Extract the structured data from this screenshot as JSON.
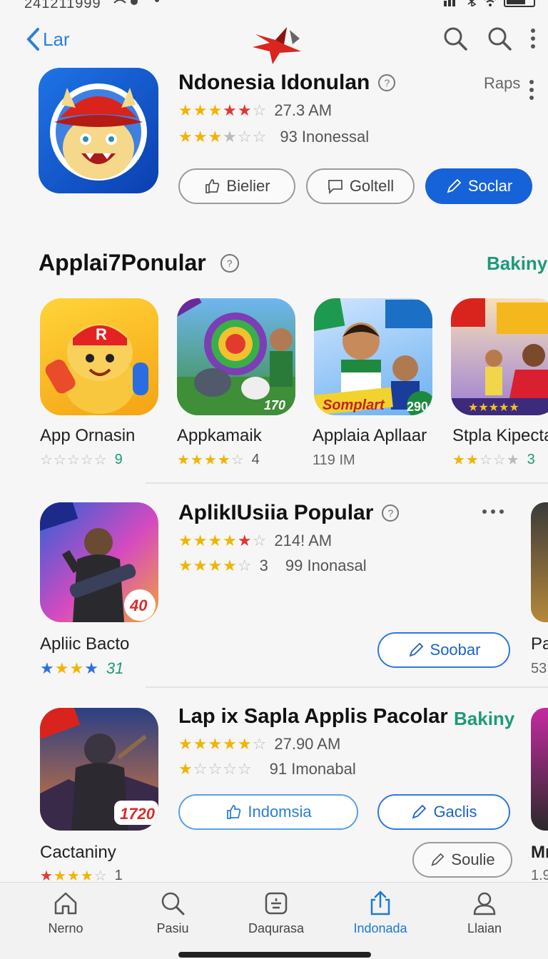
{
  "status": {
    "time": "241211999"
  },
  "nav": {
    "back_label": "Lar"
  },
  "hero": {
    "title": "Ndonesia Idonulan",
    "help": "?",
    "right_label": "Raps",
    "rating_text": "27.3 AM",
    "subrating_text": "93 Inonessal",
    "buttons": [
      "Bielier",
      "Goltell",
      "Soclar"
    ]
  },
  "section": {
    "title": "Applai7Ponular",
    "help": "?",
    "link": "Bakiny"
  },
  "carousel": [
    {
      "name": "App Ornasin",
      "meta": "9"
    },
    {
      "name": "Appkamaik",
      "meta": "4"
    },
    {
      "name": "Applaia Apllaar",
      "meta": "119 IM"
    },
    {
      "name": "Stpla Kipecta",
      "meta": "3"
    }
  ],
  "icon_badges": {
    "c2": "170",
    "c3_banner": "Somplart",
    "c3_badge": "290",
    "l1": "40",
    "l2": "1720"
  },
  "list1": {
    "title": "AplikIUsiia Popular",
    "help": "?",
    "rating_text": "214! AM",
    "subrating_value": "3",
    "subrating_text": "99 Inonasal",
    "button": "Soobar",
    "icon_name": "Apliic Bacto",
    "icon_meta": "31",
    "peek_name": "Pa",
    "peek_meta": "53"
  },
  "list2": {
    "title": "Lap ix Sapla Applis Pacolar",
    "link": "Bakiny",
    "rating_text": "27.90 AM",
    "subrating_text": "91 Imonabal",
    "buttons": [
      "Indomsia",
      "Gaclis"
    ],
    "icon_name": "Cactaniny",
    "icon_meta": "1",
    "extra_button": "Soulie",
    "peek_name": "Mı",
    "peek_meta": "1.9"
  },
  "tabs": [
    "Nerno",
    "Pasiu",
    "Daqurasa",
    "Indonada",
    "Llaian"
  ]
}
